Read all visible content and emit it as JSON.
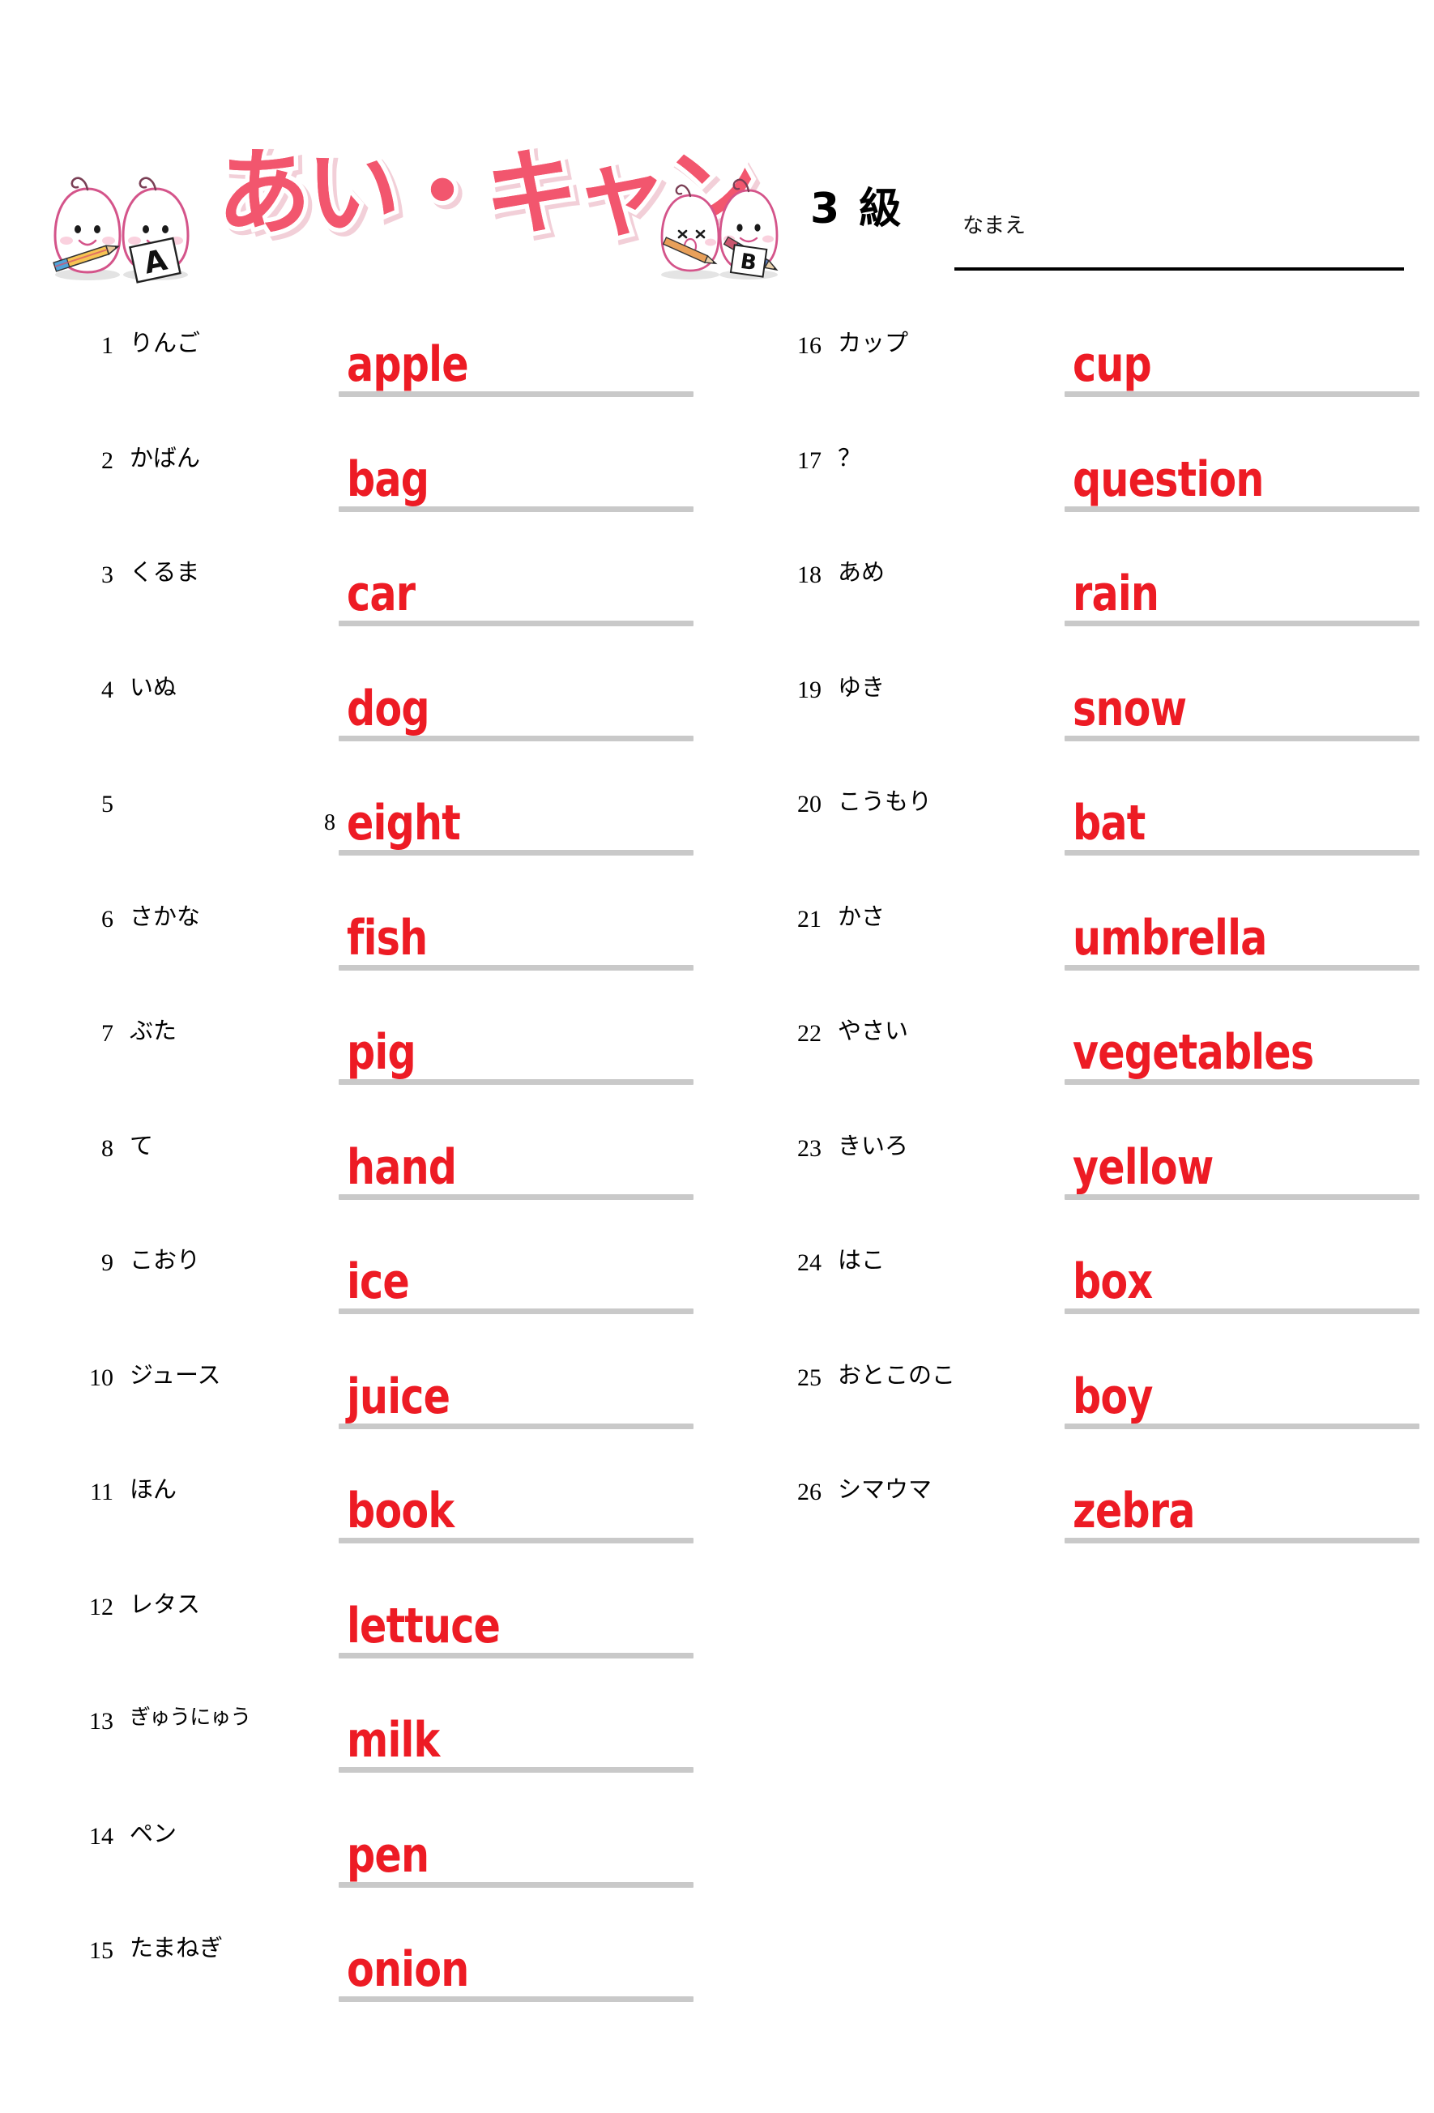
{
  "header": {
    "logo_text": "あい・キャン",
    "grade": "3 級",
    "name_label": "なまえ",
    "logo_color": "#F2566E",
    "answer_color": "#ED1B24",
    "rule_color": "#c9c9c9",
    "mascot_card_letter_left": "A",
    "mascot_card_letter_right": "B"
  },
  "left_column": [
    {
      "num": "1",
      "jp": "りんご",
      "prefix": "",
      "answer": "apple"
    },
    {
      "num": "2",
      "jp": "かばん",
      "prefix": "",
      "answer": "bag"
    },
    {
      "num": "3",
      "jp": "くるま",
      "prefix": "",
      "answer": "car"
    },
    {
      "num": "4",
      "jp": "いぬ",
      "prefix": "",
      "answer": "dog"
    },
    {
      "num": "5",
      "jp": "",
      "prefix": "8",
      "answer": "eight"
    },
    {
      "num": "6",
      "jp": "さかな",
      "prefix": "",
      "answer": "fish"
    },
    {
      "num": "7",
      "jp": "ぶた",
      "prefix": "",
      "answer": "pig"
    },
    {
      "num": "8",
      "jp": "て",
      "prefix": "",
      "answer": "hand"
    },
    {
      "num": "9",
      "jp": "こおり",
      "prefix": "",
      "answer": "ice"
    },
    {
      "num": "10",
      "jp": "ジュース",
      "prefix": "",
      "answer": "juice"
    },
    {
      "num": "11",
      "jp": "ほん",
      "prefix": "",
      "answer": "book"
    },
    {
      "num": "12",
      "jp": "レタス",
      "prefix": "",
      "answer": "lettuce"
    },
    {
      "num": "13",
      "jp": "ぎゅうにゅう",
      "prefix": "",
      "answer": "milk"
    },
    {
      "num": "14",
      "jp": "ペン",
      "prefix": "",
      "answer": "pen"
    },
    {
      "num": "15",
      "jp": "たまねぎ",
      "prefix": "",
      "answer": "onion"
    }
  ],
  "right_column": [
    {
      "num": "16",
      "jp": "カップ",
      "prefix": "",
      "answer": "cup"
    },
    {
      "num": "17",
      "jp": "？",
      "prefix": "",
      "answer": "question"
    },
    {
      "num": "18",
      "jp": "あめ",
      "prefix": "",
      "answer": "rain"
    },
    {
      "num": "19",
      "jp": "ゆき",
      "prefix": "",
      "answer": "snow"
    },
    {
      "num": "20",
      "jp": "こうもり",
      "prefix": "",
      "answer": "bat"
    },
    {
      "num": "21",
      "jp": "かさ",
      "prefix": "",
      "answer": "umbrella"
    },
    {
      "num": "22",
      "jp": "やさい",
      "prefix": "",
      "answer": "vegetables"
    },
    {
      "num": "23",
      "jp": "きいろ",
      "prefix": "",
      "answer": "yellow"
    },
    {
      "num": "24",
      "jp": "はこ",
      "prefix": "",
      "answer": "box"
    },
    {
      "num": "25",
      "jp": "おとこのこ",
      "prefix": "",
      "answer": "boy"
    },
    {
      "num": "26",
      "jp": "シマウマ",
      "prefix": "",
      "answer": "zebra"
    }
  ]
}
